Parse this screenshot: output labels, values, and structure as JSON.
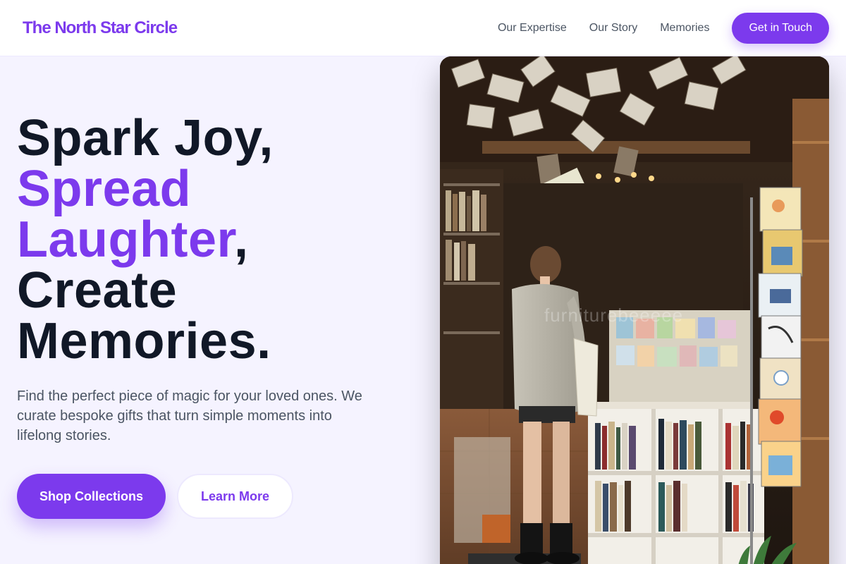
{
  "header": {
    "logo": "The North Star Circle",
    "nav": [
      "Our Expertise",
      "Our Story",
      "Memories"
    ],
    "cta": "Get in Touch"
  },
  "hero": {
    "headline": {
      "line1": "Spark Joy,",
      "line2": "Spread",
      "line3_accent": "Laughter",
      "line3_suffix": ",",
      "line4": "Create",
      "line5": "Memories."
    },
    "subtext": "Find the perfect piece of magic for your loved ones. We curate bespoke gifts that turn simple moments into lifelong stories.",
    "primary_button": "Shop Collections",
    "secondary_button": "Learn More"
  },
  "image": {
    "subject": "Person browsing a bookshop with hanging books and greeting card racks",
    "watermark": "furniturebeeeee"
  },
  "colors": {
    "accent": "#7c3aed",
    "text_dark": "#111827",
    "text_muted": "#4b5563",
    "background": "#f5f3ff"
  }
}
